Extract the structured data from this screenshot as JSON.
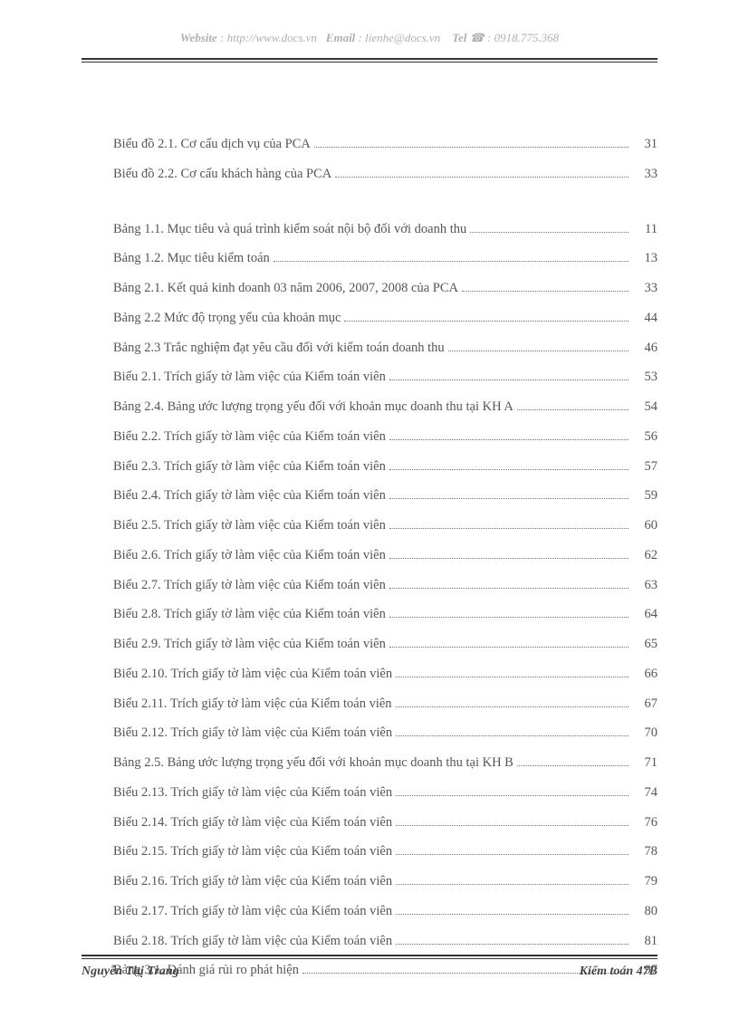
{
  "header": {
    "website_label": "Website",
    "website_value": ": http://www.docs.vn",
    "email_label": "Email",
    "email_value": " : lienhe@docs.vn",
    "tel_label": "Tel",
    "tel_icon": "☎",
    "tel_value": ": 0918.775.368"
  },
  "toc_group1": [
    {
      "text": "Biểu đồ 2.1. Cơ cấu dịch vụ của PCA",
      "page": "31"
    },
    {
      "text": "Biểu đồ 2.2. Cơ cấu khách hàng của PCA",
      "page": "33"
    }
  ],
  "toc_group2": [
    {
      "text": "Bảng 1.1. Mục tiêu và quá trình kiểm soát nội bộ đối với doanh thu",
      "page": "11"
    },
    {
      "text": "Bảng 1.2. Mục tiêu kiểm toán",
      "page": "13"
    },
    {
      "text": "Bảng 2.1. Kết quả kinh doanh 03 năm 2006, 2007, 2008 của PCA",
      "page": "33"
    },
    {
      "text": "Bảng 2.2  Mức độ trọng yếu của khoản mục",
      "page": "44"
    },
    {
      "text": "Bảng 2.3  Trắc nghiệm đạt yêu cầu đối với kiểm toán doanh thu",
      "page": "46"
    },
    {
      "text": "Biểu 2.1. Trích giấy tờ làm việc của Kiểm toán viên",
      "page": "53"
    },
    {
      "text": "Bảng 2.4. Bảng ước lượng trọng yếu đối với khoản mục doanh thu tại KH A",
      "page": "54"
    },
    {
      "text": "Biểu 2.2. Trích giấy tờ làm việc của Kiểm toán viên",
      "page": "56"
    },
    {
      "text": "Biểu 2.3. Trích giấy tờ làm việc của Kiểm toán viên",
      "page": "57"
    },
    {
      "text": "Biểu 2.4. Trích giấy tờ làm việc của Kiểm toán viên",
      "page": "59"
    },
    {
      "text": "Biểu 2.5. Trích giấy tờ làm việc của Kiểm toán viên",
      "page": "60"
    },
    {
      "text": "Biểu 2.6. Trích giấy tờ làm việc của Kiểm toán viên",
      "page": "62"
    },
    {
      "text": "Biểu 2.7. Trích giấy tờ làm việc của Kiểm toán viên",
      "page": "63"
    },
    {
      "text": "Biểu 2.8. Trích giấy tờ làm việc của Kiểm toán viên",
      "page": "64"
    },
    {
      "text": "Biểu 2.9. Trích giấy tờ làm việc của Kiểm toán viên",
      "page": "65"
    },
    {
      "text": "Biểu 2.10. Trích giấy tờ làm việc của Kiểm toán viên",
      "page": "66"
    },
    {
      "text": "Biểu 2.11. Trích giấy tờ làm việc của Kiểm toán viên",
      "page": "67"
    },
    {
      "text": "Biểu 2.12. Trích giấy tờ làm việc của Kiểm toán viên",
      "page": "70"
    },
    {
      "text": "Bảng 2.5. Bảng ước lượng trọng yếu đối với khoản mục doanh thu tại KH B",
      "page": "71"
    },
    {
      "text": "Biểu 2.13. Trích giấy tờ làm việc của Kiểm toán viên",
      "page": "74"
    },
    {
      "text": "Biểu 2.14. Trích giấy tờ làm việc của Kiểm toán viên",
      "page": "76"
    },
    {
      "text": "Biểu 2.15. Trích giấy tờ làm việc của Kiểm toán viên",
      "page": "78"
    },
    {
      "text": "Biểu 2.16. Trích giấy tờ làm việc của Kiểm toán viên",
      "page": "79"
    },
    {
      "text": "Biểu 2.17. Trích giấy tờ làm việc của Kiểm toán viên",
      "page": "80"
    },
    {
      "text": "Biểu 2.18. Trích giấy tờ làm việc của Kiểm toán viên",
      "page": "81"
    },
    {
      "text": "Bảng 3.1. Đánh giá rủi ro phát hiện",
      "page": "97"
    }
  ],
  "footer": {
    "author": "Nguyễn Thị Trang",
    "class": "Kiểm toán 47B"
  }
}
